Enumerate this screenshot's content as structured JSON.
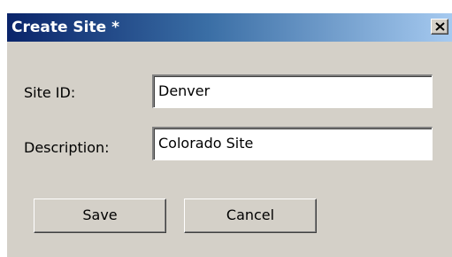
{
  "window": {
    "title": "Create Site *",
    "close_icon": "close-icon"
  },
  "form": {
    "site_id_label": "Site ID:",
    "site_id_value": "Denver",
    "description_label": "Description:",
    "description_value": "Colorado Site"
  },
  "buttons": {
    "save_label": "Save",
    "cancel_label": "Cancel"
  },
  "colors": {
    "titlebar_start": "#0a246a",
    "titlebar_end": "#a6caf0",
    "dialog_background": "#d4d0c8"
  }
}
